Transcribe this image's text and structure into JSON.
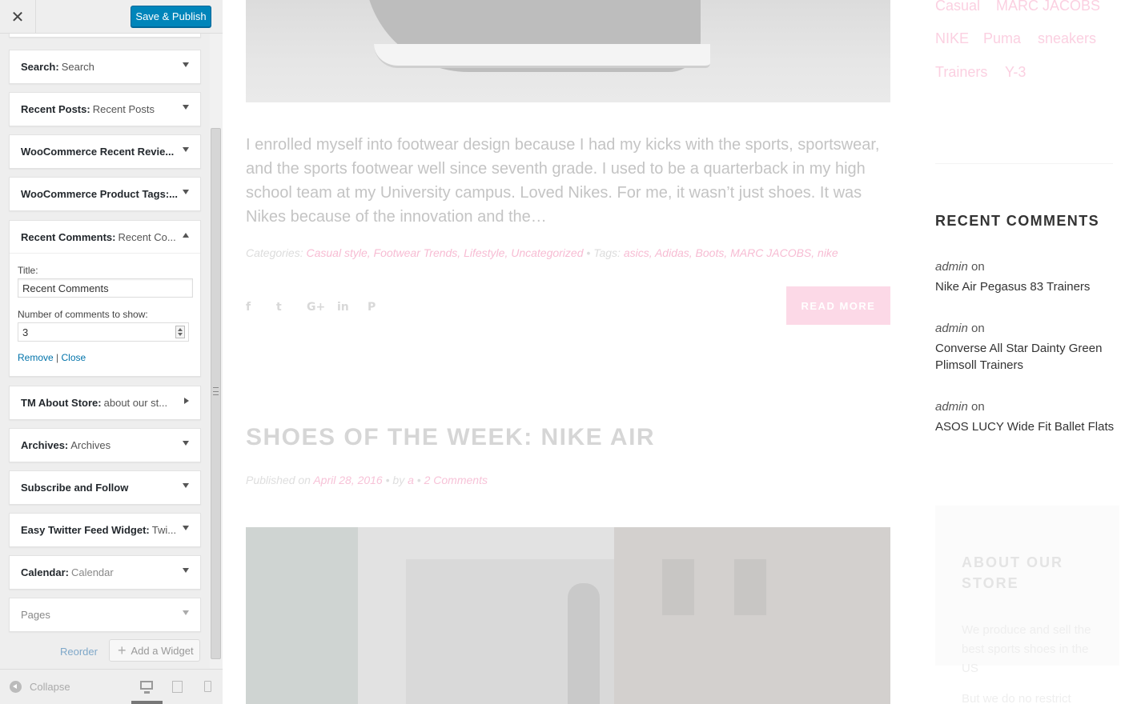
{
  "sidebar": {
    "close_symbol": "✕",
    "save_publish": "Save & Publish",
    "widgets": [
      {
        "name": "Search:",
        "sub": "Search"
      },
      {
        "name": "Recent Posts:",
        "sub": "Recent Posts"
      },
      {
        "name": "WooCommerce Recent Revie...",
        "sub": ""
      },
      {
        "name": "WooCommerce Product Tags:...",
        "sub": ""
      },
      {
        "name": "Recent Comments:",
        "sub": "Recent Co..."
      },
      {
        "name": "TM About Store:",
        "sub": "about our st..."
      },
      {
        "name": "Archives:",
        "sub": "Archives"
      },
      {
        "name": "Subscribe and Follow",
        "sub": ""
      },
      {
        "name": "Easy Twitter Feed Widget:",
        "sub": "Twi..."
      },
      {
        "name": "Calendar:",
        "sub": "Calendar"
      },
      {
        "name": "Pages",
        "sub": ""
      }
    ],
    "comments_form": {
      "title_label": "Title:",
      "title_value": "Recent Comments",
      "number_label": "Number of comments to show:",
      "number_value": "3",
      "remove": "Remove",
      "separator": "|",
      "close": "Close"
    },
    "reorder": "Reorder",
    "add_widget": "Add a Widget",
    "collapse": "Collapse"
  },
  "preview": {
    "excerpt": "I enrolled myself into footwear design because I had my kicks with the sports, sportswear, and the sports footwear well since seventh grade. I used to be a quarterback in my high school team at my University campus. Loved Nikes. For me, it wasn’t just shoes. It was Nikes because of the innovation and the…",
    "meta": {
      "categories_label": "Categories:",
      "categories": "Casual style, Footwear Trends, Lifestyle, Uncategorized",
      "dot": "•",
      "tags_label": "Tags:",
      "tags": "asics, Adidas, Boots, MARC JACOBS, nike"
    },
    "share_icons": [
      "f",
      "t",
      "G+",
      "in",
      "P"
    ],
    "read_more": "READ MORE",
    "post_title": "SHOES OF THE WEEK: NIKE AIR",
    "post_meta": {
      "published_on": "Published on",
      "date": "April 28, 2016",
      "dot": "•",
      "by": "by",
      "author": "a",
      "comments": "2 Comments"
    },
    "tags_cloud": [
      "Casual",
      "MARC JACOBS",
      "NIKE",
      "Puma",
      "sneakers",
      "Trainers",
      "Y-3"
    ],
    "recent_comments": {
      "heading": "RECENT COMMENTS",
      "items": [
        {
          "author": "admin",
          "on": "on",
          "post": "Nike Air Pegasus 83 Trainers"
        },
        {
          "author": "admin",
          "on": "on",
          "post": "Converse All Star Dainty Green Plimsoll Trainers"
        },
        {
          "author": "admin",
          "on": "on",
          "post": "ASOS LUCY Wide Fit Ballet Flats"
        }
      ]
    },
    "about": {
      "title": "ABOUT OUR STORE",
      "text": "We produce and sell the best sports shoes in the US",
      "text2": "But we do no restrict"
    }
  }
}
